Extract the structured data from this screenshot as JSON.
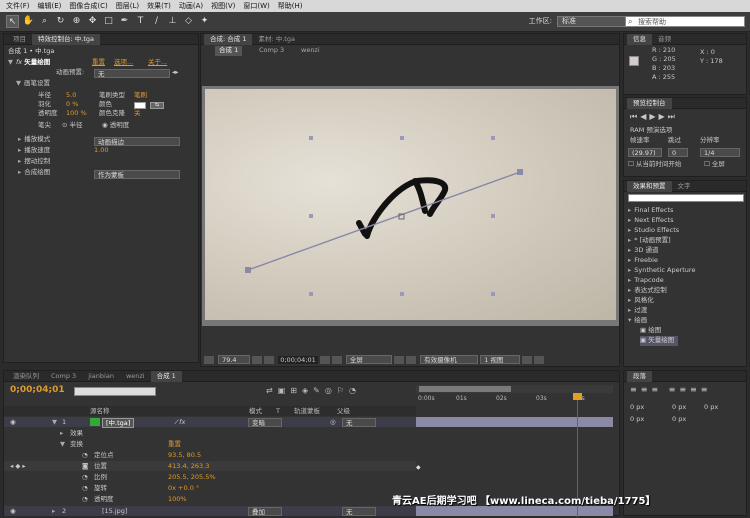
{
  "menu": [
    "文件(F)",
    "编辑(E)",
    "图像合成(C)",
    "图层(L)",
    "效果(T)",
    "动画(A)",
    "视图(V)",
    "窗口(W)",
    "帮助(H)"
  ],
  "workspace": {
    "label": "工作区:",
    "value": "标准"
  },
  "search": {
    "placeholder": "搜索帮助"
  },
  "project_tab": "项目",
  "effects_tab": "特效控制台: 中.tga",
  "effects": {
    "breadcrumb": "合成 1 • 中.tga",
    "fx_name": "矢量绘图",
    "reset": "重置",
    "options": "选项...",
    "about": "关于...",
    "preset_label": "动画预置:",
    "preset_value": "无",
    "brush_group": "画笔设置",
    "radius_label": "半径",
    "radius_val": "5.0",
    "feather_label": "羽化",
    "feather_val": "0 %",
    "opacity_label": "透明度",
    "opacity_val": "100 %",
    "brush_type_label": "笔刷类型",
    "brush_type_val": "笔刷",
    "color_label": "颜色",
    "color_val": "#ffffff",
    "color_cb_label": "颜色克隆",
    "color_cb_val": "关",
    "nib_label": "笔尖",
    "nib_radius": "半径",
    "nib_opacity": "透明度",
    "play_mode_label": "播放模式",
    "play_mode_val": "动画描边",
    "play_speed_label": "播放速度",
    "play_speed_val": "1.00",
    "motion_label": "摆动控制",
    "composite_label": "合成绘图",
    "composite_val": "作为蒙板"
  },
  "comp_tabs": {
    "comp": "合成: 合成 1",
    "footage": "素材: 中.tga"
  },
  "flowchart": {
    "a": "合成 1",
    "b": "Comp 3",
    "c": "wenzi"
  },
  "viewer_status": {
    "zoom": "79.4",
    "time": "0;00;04;01",
    "res": "全屏",
    "camera": "有效摄像机",
    "views": "1 视图"
  },
  "info": {
    "tab": "信息",
    "tab2": "音频",
    "r": "R : 210",
    "g": "G : 205",
    "b": "B : 203",
    "a": "A : 255",
    "x": "X : 0",
    "y": "Y : 178"
  },
  "preview": {
    "tab": "预览控制台",
    "ram": "RAM 预演选项",
    "fr_label": "帧速率",
    "skip_label": "跳过",
    "res_label": "分辨率",
    "fr": "(29.97)",
    "skip": "0",
    "res": "1/4",
    "from_now": "从当前时间开始",
    "full": "全屏"
  },
  "fxpresets": {
    "tab": "效果和预置",
    "tab2": "文字",
    "items": [
      "Final Effects",
      "Next Effects",
      "Studio Effects",
      "* [动画预置]",
      "3D 通道",
      "Freebie",
      "Synthetic Aperture",
      "Trapcode",
      "表达式控制",
      "风格化",
      "过渡",
      "绘画",
      "绘图",
      "矢量绘图"
    ]
  },
  "para": {
    "tab": "段落",
    "px": "0 px"
  },
  "timeline": {
    "tabs": [
      "渲染队列",
      "Comp 3",
      "jianbian",
      "wenzi",
      "合成 1"
    ],
    "timecode": "0;00;04;01",
    "col_name": "源名称",
    "col_mode": "模式",
    "col_t": "T",
    "col_trk": "轨道蒙板",
    "col_parent": "父级",
    "ticks": [
      "0:00s",
      "01s",
      "02s",
      "03s",
      "04s"
    ],
    "layer1_num": "1",
    "layer1_name": "[中.tga]",
    "mode1": "变暗",
    "parent1": "无",
    "effects": "效果",
    "transform": "变换",
    "reset": "重置",
    "anchor": "定位点",
    "anchor_val": "93.5, 80.5",
    "position": "位置",
    "position_val": "413.4, 263.3",
    "scale": "比例",
    "scale_val": "205.5, 205.5%",
    "rotation": "旋转",
    "rotation_val": "0x +0.0 °",
    "opacity": "透明度",
    "opacity_val": "100%",
    "layer2_num": "2",
    "layer2_name": "[15.jpg]",
    "mode2": "叠加",
    "parent2": "无"
  },
  "watermark": "青云AE后期学习吧 【www.lineca.com/tieba/1775】"
}
